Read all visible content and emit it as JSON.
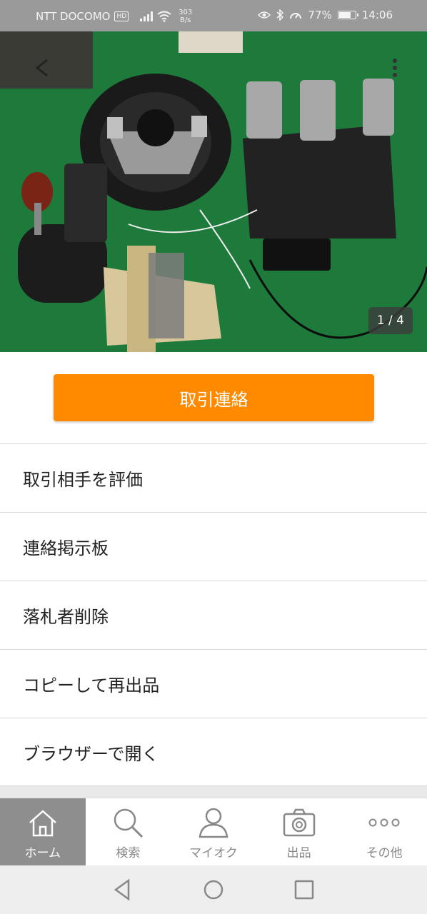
{
  "status_bar": {
    "carrier": "NTT DOCOMO",
    "hd_badge": "HD",
    "net_speed_value": "303",
    "net_speed_unit": "B/s",
    "battery_percent": "77%",
    "battery_level": 0.77,
    "time": "14:06"
  },
  "photo": {
    "counter": "1 / 4"
  },
  "primary_action": {
    "label": "取引連絡",
    "color": "#ff8a00"
  },
  "menu": {
    "items": [
      {
        "label": "取引相手を評価"
      },
      {
        "label": "連絡掲示板"
      },
      {
        "label": "落札者削除"
      },
      {
        "label": "コピーして再出品"
      },
      {
        "label": "ブラウザーで開く"
      }
    ]
  },
  "tabbar": {
    "tabs": [
      {
        "label": "ホーム",
        "icon": "home-icon",
        "active": true
      },
      {
        "label": "検索",
        "icon": "search-icon",
        "active": false
      },
      {
        "label": "マイオク",
        "icon": "person-icon",
        "active": false
      },
      {
        "label": "出品",
        "icon": "camera-icon",
        "active": false
      },
      {
        "label": "その他",
        "icon": "more-dots-icon",
        "active": false
      }
    ]
  },
  "navbar": {
    "buttons": [
      "back-triangle-icon",
      "home-circle-icon",
      "recents-square-icon"
    ]
  }
}
